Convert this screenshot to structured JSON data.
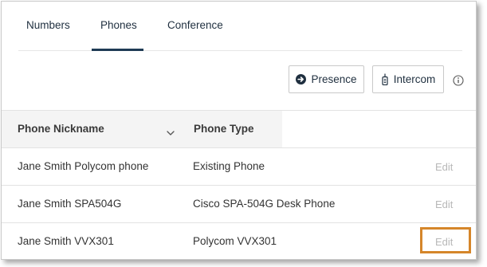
{
  "tabs": [
    {
      "label": "Numbers",
      "active": false
    },
    {
      "label": "Phones",
      "active": true
    },
    {
      "label": "Conference",
      "active": false
    }
  ],
  "actions": {
    "presence_label": "Presence",
    "intercom_label": "Intercom"
  },
  "icons": {
    "presence": "arrow-right-circle-icon",
    "intercom": "handset-icon",
    "info": "info-circle-icon",
    "sort": "chevron-down-icon"
  },
  "table": {
    "columns": [
      "Phone Nickname",
      "Phone Type"
    ],
    "rows": [
      {
        "nickname": "Jane Smith Polycom phone",
        "type": "Existing Phone",
        "action": "Edit"
      },
      {
        "nickname": "Jane Smith SPA504G",
        "type": "Cisco SPA-504G Desk Phone",
        "action": "Edit"
      },
      {
        "nickname": "Jane Smith VVX301",
        "type": "Polycom VVX301",
        "action": "Edit"
      }
    ]
  },
  "colors": {
    "accent": "#1f3b55",
    "highlight": "#d5862a",
    "disabled_text": "#b8b8b8",
    "header_bg": "#f4f4f4"
  }
}
